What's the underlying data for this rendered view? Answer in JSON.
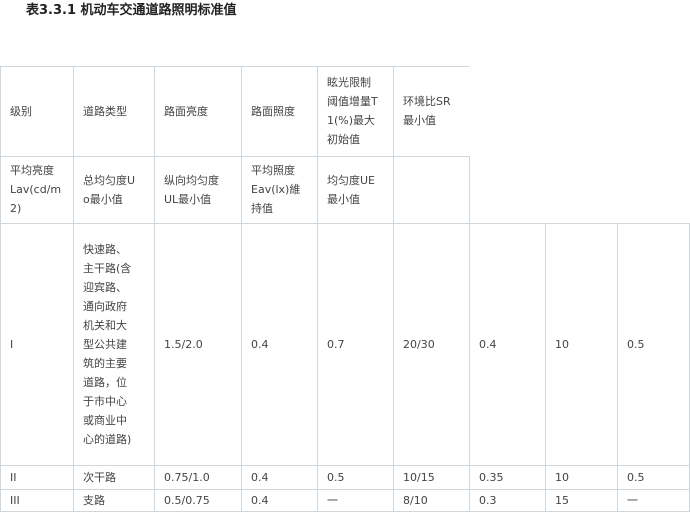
{
  "title": "表3.3.1 机动车交通道路照明标准值",
  "header_row1": [
    "级别",
    "道路类型",
    "路面亮度",
    "路面照度",
    "眩光限制\n阈值增量T\n1(%)最大\n初始值",
    "环境比SR\n最小值"
  ],
  "header_row2": [
    "平均亮度\nLav(cd/m\n2)",
    "总均匀度U\no最小值",
    "纵向均匀度\nUL最小值",
    "平均照度\nEav(lx)維\n持值",
    "均匀度UE\n最小值"
  ],
  "rows": [
    {
      "level": "I",
      "road_type": "快速路、\n主干路(含\n迎宾路、\n通向政府\n机关和大\n型公共建\n筑的主要\n道路，位\n于市中心\n或商业中\n心的道路)",
      "values": [
        "1.5/2.0",
        "0.4",
        "0.7",
        "20/30",
        "0.4",
        "10",
        "0.5"
      ]
    },
    {
      "level": "II",
      "road_type": "次干路",
      "values": [
        "0.75/1.0",
        "0.4",
        "0.5",
        "10/15",
        "0.35",
        "10",
        "0.5"
      ]
    },
    {
      "level": "III",
      "road_type": "支路",
      "values": [
        "0.5/0.75",
        "0.4",
        "一",
        "8/10",
        "0.3",
        "15",
        "一"
      ]
    }
  ]
}
